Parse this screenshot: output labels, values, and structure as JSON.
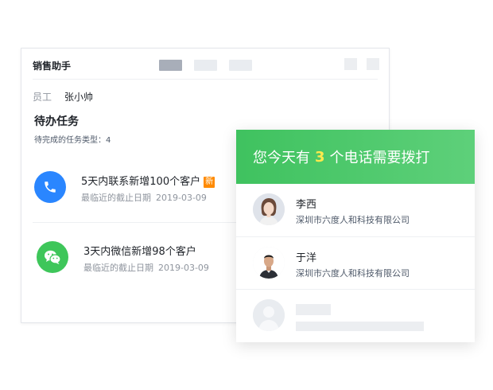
{
  "app": {
    "title": "销售助手"
  },
  "staff": {
    "label": "员工",
    "name": "张小帅"
  },
  "tasks_section": {
    "title": "待办任务",
    "subtitle": "待完成的任务类型：4"
  },
  "tasks": [
    {
      "icon": "phone-icon",
      "title": "5天内联系新增100个客户",
      "badge": "新",
      "deadline_label": "最临近的截止日期",
      "deadline_date": "2019-03-09"
    },
    {
      "icon": "wechat-icon",
      "title": "3天内微信新增98个客户",
      "deadline_label": "最临近的截止日期",
      "deadline_date": "2019-03-09"
    }
  ],
  "call_card": {
    "prefix": "您今天有",
    "count": "3",
    "suffix": "个电话需要拨打",
    "contacts": [
      {
        "name": "李西",
        "company": "深圳市六度人和科技有限公司"
      },
      {
        "name": "于洋",
        "company": "深圳市六度人和科技有限公司"
      }
    ]
  },
  "colors": {
    "accent_blue": "#2a86ff",
    "accent_green": "#3ec65a",
    "badge_orange": "#ff8a00",
    "highlight_yellow": "#ffe94d"
  }
}
